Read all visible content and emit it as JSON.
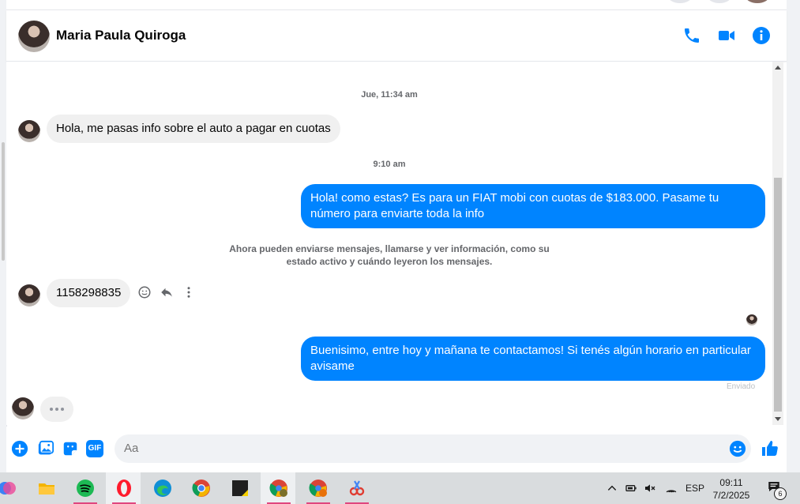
{
  "contact": {
    "name": "Maria Paula Quiroga"
  },
  "header_icons": [
    "phone-icon",
    "video-camera-icon",
    "info-icon"
  ],
  "messages": {
    "ts1": "Jue, 11:34 am",
    "in1": "Hola, me pasas info sobre el auto a pagar en cuotas",
    "ts2": "9:10 am",
    "out1": "Hola! como estas? Es para un FIAT mobi con cuotas de $183.000. Pasame tu número para enviarte toda la info",
    "notice": "Ahora pueden enviarse mensajes, llamarse y ver información, como su estado activo y cuándo leyeron los mensajes.",
    "in2": "1158298835",
    "out2": "Buenisimo, entre hoy y mañana te contactamos! Si tenés algún horario en particular avisame",
    "status": "Enviado"
  },
  "composer": {
    "placeholder": "Aa",
    "gif_label": "GIF"
  },
  "taskbar": {
    "lang": "ESP",
    "time": "09:11",
    "date": "7/2/2025",
    "notifications": "6"
  },
  "colors": {
    "accent": "#0084ff",
    "incoming_bubble": "#f0f0f0"
  }
}
